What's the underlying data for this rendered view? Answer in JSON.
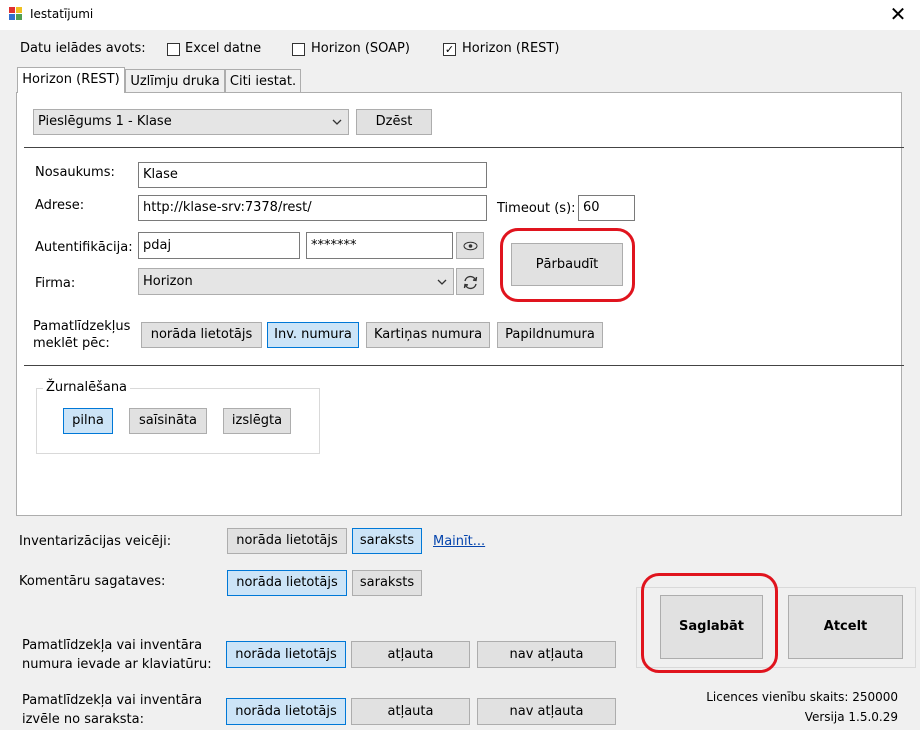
{
  "window": {
    "title": "Iestatījumi",
    "close_glyph": "✕"
  },
  "source": {
    "label": "Datu ielādes avots:",
    "options": [
      {
        "label": "Excel datne",
        "checked": false
      },
      {
        "label": "Horizon (SOAP)",
        "checked": false
      },
      {
        "label": "Horizon (REST)",
        "checked": true
      }
    ],
    "check_glyph": "✓"
  },
  "tabs": [
    "Horizon (REST)",
    "Uzlīmju druka",
    "Citi iestat."
  ],
  "connection": {
    "selected": "Pieslēgums 1 - Klase",
    "delete_label": "Dzēst",
    "name_label": "Nosaukums:",
    "name_value": "Klase",
    "address_label": "Adrese:",
    "address_value": "http://klase-srv:7378/rest/",
    "timeout_label": "Timeout (s):",
    "timeout_value": "60",
    "auth_label": "Autentifikācija:",
    "user_value": "pdaj",
    "password_value": "*******",
    "company_label": "Firma:",
    "company_value": "Horizon",
    "check_label": "Pārbaudīt"
  },
  "asset_search": {
    "label_line1": "Pamatlīdzekļus",
    "label_line2": "meklēt pēc:",
    "options": [
      "norāda lietotājs",
      "Inv. numura",
      "Kartiņas numura",
      "Papildnumura"
    ],
    "selected_index": 1
  },
  "logging": {
    "label": "Žurnalēšana",
    "options": [
      "pilna",
      "saīsināta",
      "izslēgta"
    ],
    "selected_index": 0
  },
  "inventory_performers": {
    "label": "Inventarizācijas veicēji:",
    "options": [
      "norāda lietotājs",
      "saraksts"
    ],
    "selected_index": 1,
    "change_link": "Mainīt..."
  },
  "comment_templates": {
    "label": "Komentāru sagataves:",
    "options": [
      "norāda lietotājs",
      "saraksts"
    ],
    "selected_index": 0
  },
  "keyboard_entry": {
    "label_line1": "Pamatlīdzekļa vai inventāra",
    "label_line2": "numura ievade ar klaviatūru:",
    "options": [
      "norāda lietotājs",
      "atļauta",
      "nav atļauta"
    ],
    "selected_index": 0
  },
  "list_selection": {
    "label_line1": "Pamatlīdzekļa vai inventāra",
    "label_line2": "izvēle no saraksta:",
    "options": [
      "norāda lietotājs",
      "atļauta",
      "nav atļauta"
    ],
    "selected_index": 0
  },
  "actions": {
    "save_label": "Saglabāt",
    "cancel_label": "Atcelt"
  },
  "footer": {
    "licence": "Licences vienību skaits: 250000",
    "version": "Versija 1.5.0.29"
  },
  "colors": {
    "highlight_ring": "#e0141e",
    "selected_button": "#cce4f7",
    "selected_border": "#0078d7",
    "link": "#0645ad"
  }
}
